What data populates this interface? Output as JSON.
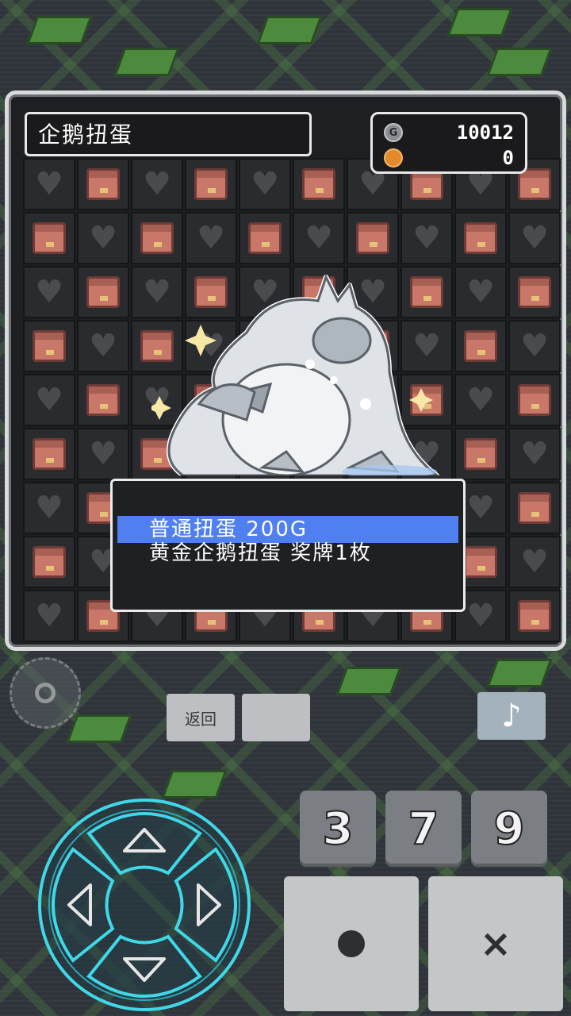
{
  "title": "企鹅扭蛋",
  "currency": {
    "gear_icon_label": "G",
    "gold": "10012",
    "medals": "0"
  },
  "menu": {
    "items": [
      {
        "label": "普通扭蛋 200G",
        "selected": true
      },
      {
        "label": "黄金企鹅扭蛋 奖牌1枚",
        "selected": false
      }
    ],
    "highlight_color": "#4f7ff0"
  },
  "controls": {
    "back_label": "返回",
    "blank_label": "",
    "music_icon": "♪",
    "num_buttons": [
      "3",
      "7",
      "9"
    ],
    "circle_button_icon": "circle-icon",
    "cross_button_icon": "×"
  },
  "dpad": {
    "glow_color": "#3fd8e8"
  }
}
